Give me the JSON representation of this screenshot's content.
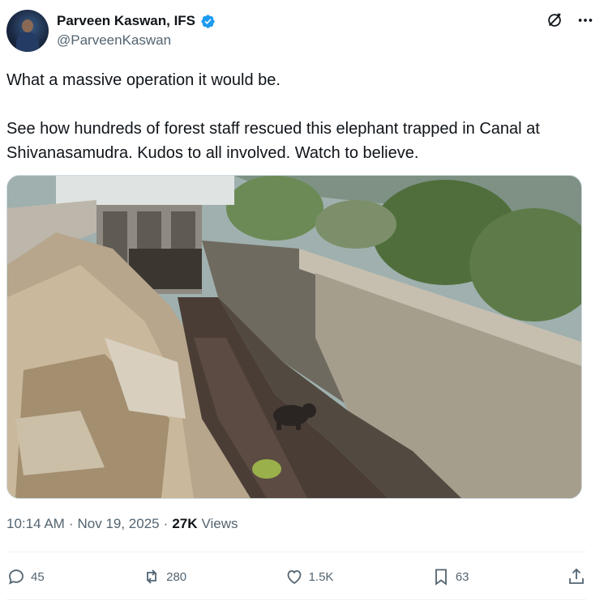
{
  "author": {
    "display_name": "Parveen Kaswan, IFS",
    "handle": "@ParveenKaswan",
    "verified": true
  },
  "top_icons": [
    "grok-icon",
    "more-icon"
  ],
  "tweet": {
    "line1": "What a massive operation it would be.",
    "line2": "See how hundreds of forest staff rescued this elephant trapped in Canal at Shivanasamudra. Kudos to all involved. Watch to believe."
  },
  "meta": {
    "time": "10:14 AM",
    "date": "Nov 19, 2025",
    "views_count": "27K",
    "views_label": "Views",
    "separator": "·"
  },
  "actions": {
    "replies": "45",
    "reposts": "280",
    "likes": "1.5K",
    "bookmarks": "63"
  },
  "colors": {
    "text": "#0f1419",
    "secondary": "#536471",
    "verified": "#1d9bf0",
    "divider": "#eff3f4"
  }
}
